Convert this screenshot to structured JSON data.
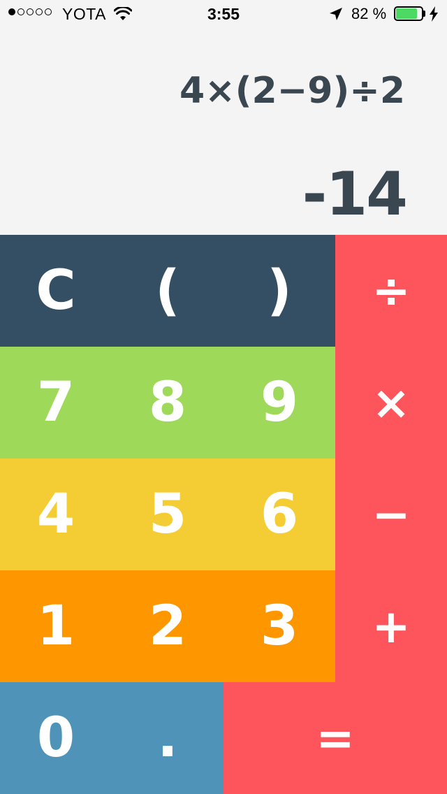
{
  "status_bar": {
    "signal_bars": 5,
    "signal_filled": 1,
    "carrier": "YOTA",
    "time": "3:55",
    "battery_percent": "82 %",
    "battery_level": 0.82,
    "icons": [
      "wifi-icon",
      "location-arrow-icon",
      "battery-icon",
      "charging-bolt-icon"
    ]
  },
  "display": {
    "expression": "4×(2−9)÷2",
    "result": "-14"
  },
  "colors": {
    "background": "#f5f4f5",
    "display_text": "#3a4750",
    "row_function": "#344f63",
    "row_789": "#9fd95a",
    "row_456": "#f4cd35",
    "row_123": "#fe9600",
    "row_zero": "#4f94b8",
    "operator": "#fe545b",
    "key_text": "#ffffff"
  },
  "keypad": {
    "function_row": [
      "C",
      "(",
      ")"
    ],
    "row_789": [
      "7",
      "8",
      "9"
    ],
    "row_456": [
      "4",
      "5",
      "6"
    ],
    "row_123": [
      "1",
      "2",
      "3"
    ],
    "zero": "0",
    "decimal": ".",
    "operators": [
      "÷",
      "×",
      "−",
      "+"
    ],
    "equals": "="
  }
}
